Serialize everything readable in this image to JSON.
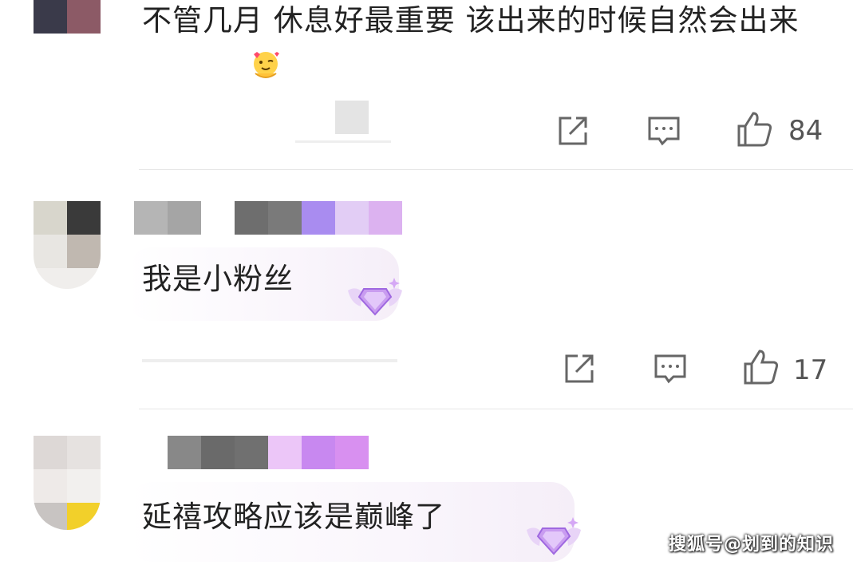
{
  "comments": [
    {
      "text": "不管几月 休息好最重要 该出来的时候自然会出来",
      "like_count": "84"
    },
    {
      "text": "我是小粉丝",
      "like_count": "17"
    },
    {
      "text": "延禧攻略应该是巅峰了"
    }
  ],
  "icons": [
    "share-icon",
    "reply-icon",
    "like-icon",
    "fan-badge-icon"
  ],
  "watermark": "搜狐号@划到的知识",
  "colors": {
    "accent_purple": "#b48cf0",
    "text": "#222222",
    "icon": "#666666"
  }
}
